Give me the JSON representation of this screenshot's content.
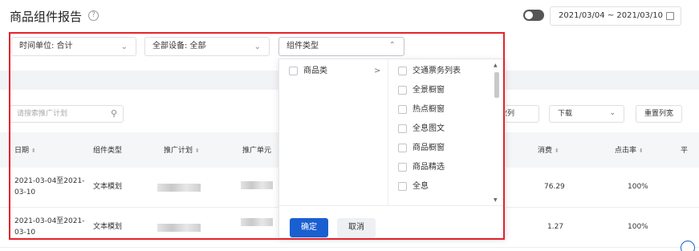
{
  "header": {
    "title": "商品组件报告",
    "help_icon": "?",
    "date_range": "2021/03/04 ~ 2021/03/10"
  },
  "filters": {
    "time_unit": "时间单位: 合计",
    "devices": "全部设备: 全部",
    "component_type_placeholder": "组件类型"
  },
  "toolbar": {
    "search_placeholder": "请搜索推广计划",
    "col_partial": "改列",
    "download": "下载",
    "reset_columns": "重置列宽"
  },
  "table": {
    "headers": [
      "日期",
      "组件类型",
      "推广计划",
      "推广单元",
      "消费",
      "点击率",
      "平"
    ],
    "rows": [
      {
        "date": "2021-03-04至2021-03-10",
        "type": "文本模划",
        "spend": "76.29",
        "ctr": "100%"
      },
      {
        "date": "2021-03-04至2021-03-10",
        "type": "文本模划",
        "spend": "1.27",
        "ctr": "100%"
      }
    ]
  },
  "dropdown": {
    "left": [
      {
        "label": "商品类",
        "arrow": ">"
      }
    ],
    "right": [
      "交通票务列表",
      "全景橱窗",
      "热点橱窗",
      "全息图文",
      "商品橱窗",
      "商品精选",
      "全息"
    ],
    "confirm": "确定",
    "cancel": "取消"
  },
  "colors": {
    "primary": "#1a5fd1",
    "highlight_border": "#e6222c"
  }
}
